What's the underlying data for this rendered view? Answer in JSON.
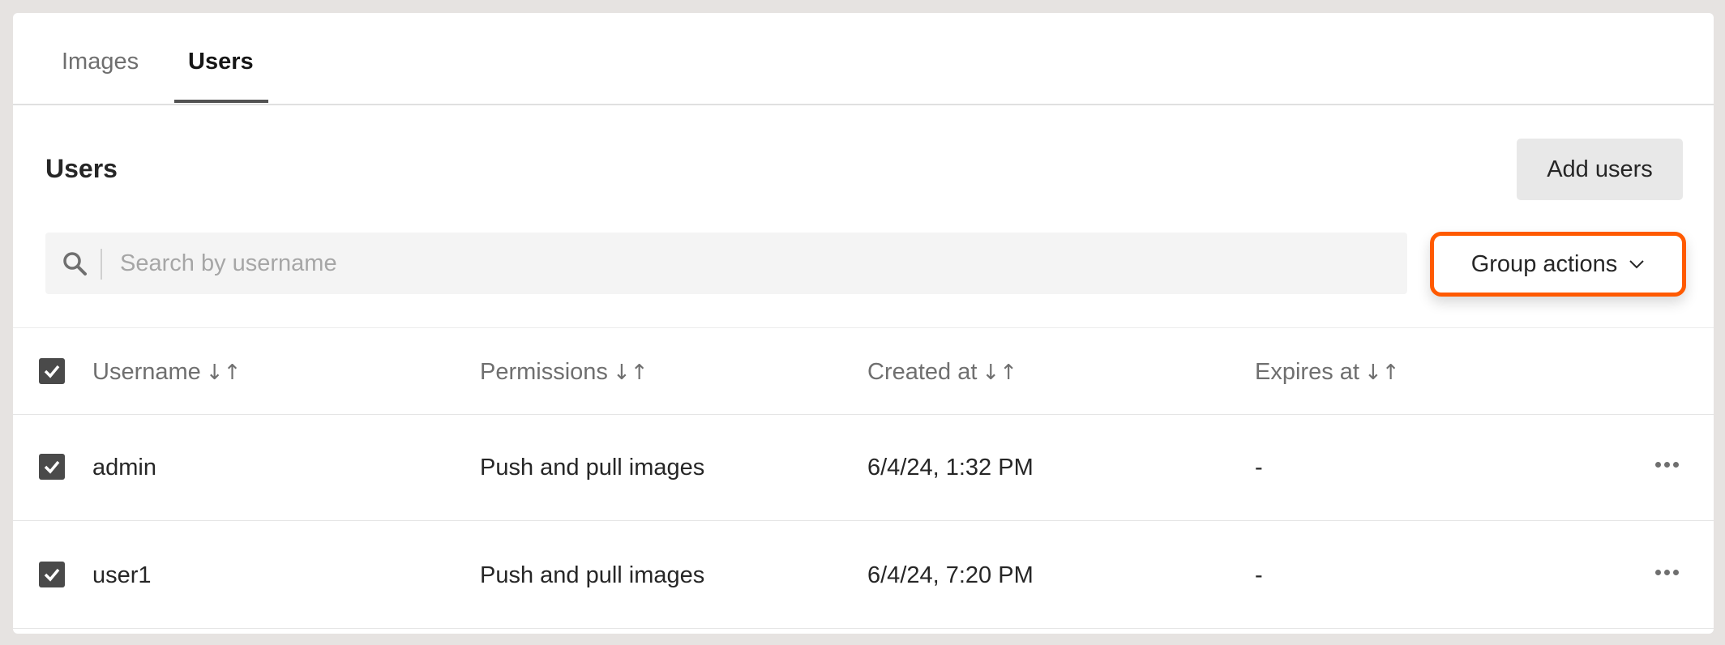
{
  "tabs": [
    {
      "label": "Images",
      "active": false
    },
    {
      "label": "Users",
      "active": true
    }
  ],
  "section": {
    "title": "Users",
    "add_button_label": "Add users"
  },
  "search": {
    "placeholder": "Search by username",
    "value": ""
  },
  "group_actions": {
    "label": "Group actions",
    "highlight_color": "#ff5a00"
  },
  "table": {
    "columns": [
      {
        "label": "Username",
        "sort_icon": "↓↑"
      },
      {
        "label": "Permissions",
        "sort_icon": "↓↑"
      },
      {
        "label": "Created at",
        "sort_icon": "↓↑"
      },
      {
        "label": "Expires at",
        "sort_icon": "↓↑"
      }
    ],
    "header_checked": true,
    "rows": [
      {
        "checked": true,
        "username": "admin",
        "permissions": "Push and pull images",
        "created_at": "6/4/24, 1:32 PM",
        "expires_at": "-"
      },
      {
        "checked": true,
        "username": "user1",
        "permissions": "Push and pull images",
        "created_at": "6/4/24, 7:20 PM",
        "expires_at": "-"
      }
    ]
  },
  "icons": {
    "search": "search-icon",
    "checkbox": "checkmark-icon",
    "chevron": "chevron-down-icon",
    "overflow": "more-horizontal-icon"
  }
}
